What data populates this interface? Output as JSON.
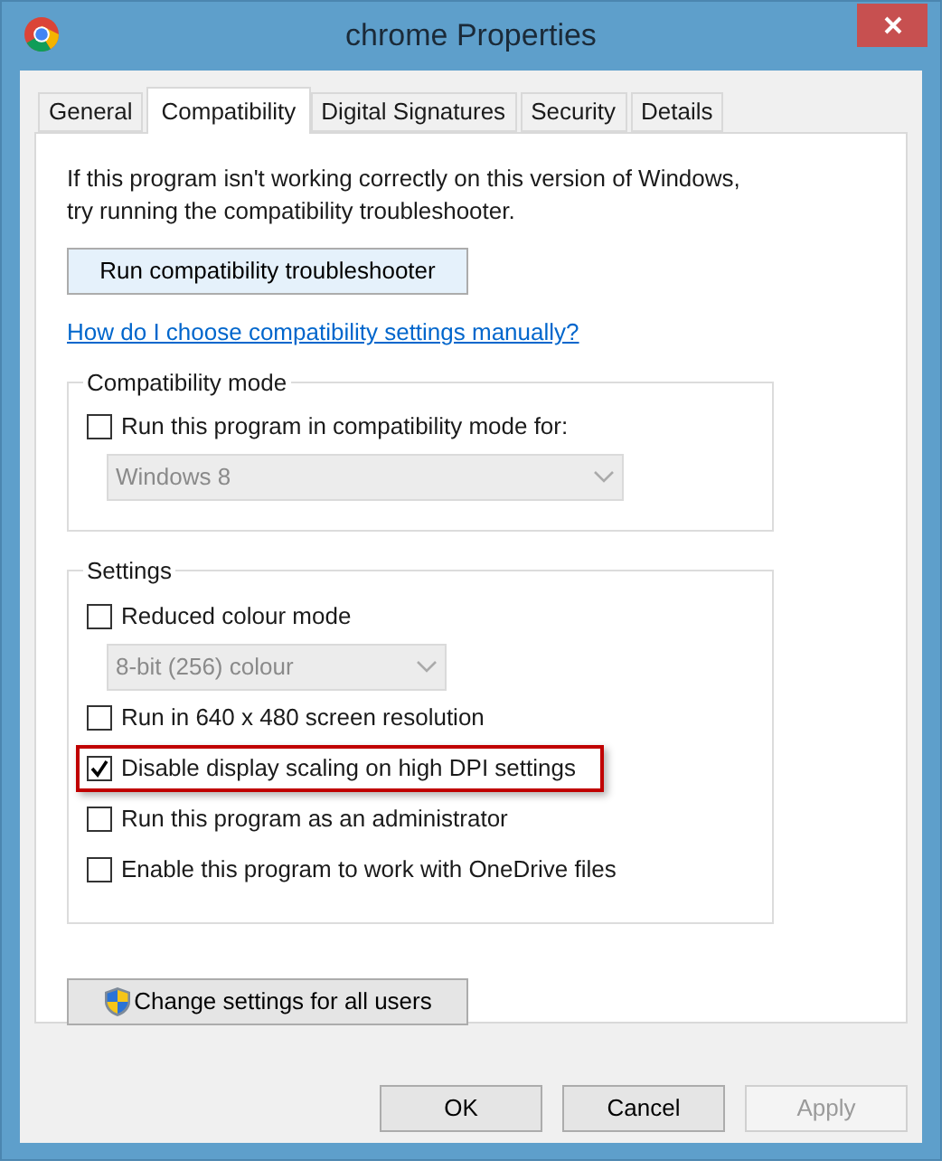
{
  "window": {
    "title": "chrome Properties"
  },
  "tabs": [
    {
      "label": "General",
      "selected": false
    },
    {
      "label": "Compatibility",
      "selected": true
    },
    {
      "label": "Digital Signatures",
      "selected": false
    },
    {
      "label": "Security",
      "selected": false
    },
    {
      "label": "Details",
      "selected": false
    }
  ],
  "intro": "If this program isn't working correctly on this version of Windows, try running the compatibility troubleshooter.",
  "troubleshooter_button": "Run compatibility troubleshooter",
  "help_link": "How do I choose compatibility settings manually?",
  "groups": [
    {
      "title": "Compatibility mode",
      "items": [
        {
          "kind": "checkbox",
          "label": "Run this program in compatibility mode for:",
          "checked": false,
          "highlighted": false
        },
        {
          "kind": "dropdown",
          "value": "Windows 8",
          "disabled": true
        }
      ]
    },
    {
      "title": "Settings",
      "items": [
        {
          "kind": "checkbox",
          "label": "Reduced colour mode",
          "checked": false,
          "highlighted": false
        },
        {
          "kind": "dropdown",
          "value": "8-bit (256) colour",
          "disabled": true
        },
        {
          "kind": "checkbox",
          "label": "Run in 640 x 480 screen resolution",
          "checked": false,
          "highlighted": false
        },
        {
          "kind": "checkbox",
          "label": "Disable display scaling on high DPI settings",
          "checked": true,
          "highlighted": true
        },
        {
          "kind": "checkbox",
          "label": "Run this program as an administrator",
          "checked": false,
          "highlighted": false
        },
        {
          "kind": "checkbox",
          "label": "Enable this program to work with OneDrive files",
          "checked": false,
          "highlighted": false
        }
      ]
    }
  ],
  "all_users_button": "Change settings for all users",
  "buttons": [
    {
      "label": "OK",
      "disabled": false
    },
    {
      "label": "Cancel",
      "disabled": false
    },
    {
      "label": "Apply",
      "disabled": true
    }
  ]
}
